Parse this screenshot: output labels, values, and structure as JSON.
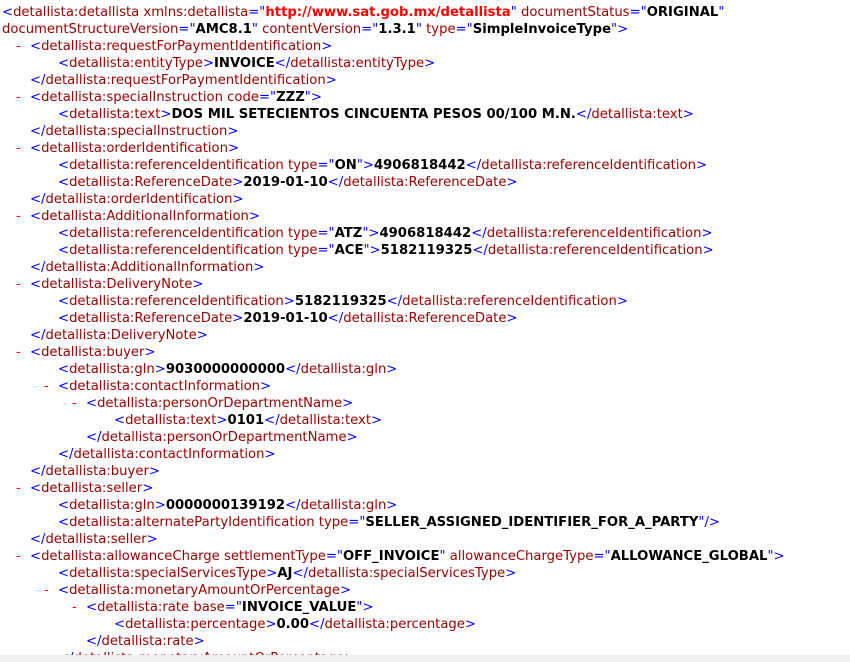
{
  "lines": [
    {
      "i": 0,
      "toggle": "",
      "parts": [
        [
          "b",
          "<"
        ],
        [
          "t",
          "detallista:detallista"
        ],
        [
          "an",
          " xmlns:detallista"
        ],
        [
          "b",
          "=\""
        ],
        [
          "ns",
          "http://www.sat.gob.mx/detallista"
        ],
        [
          "b",
          "\""
        ],
        [
          "an",
          " documentStatus"
        ],
        [
          "b",
          "=\""
        ],
        [
          "av",
          "ORIGINAL"
        ],
        [
          "b",
          "\""
        ]
      ]
    },
    {
      "i": 0,
      "toggle": "",
      "parts": [
        [
          "an",
          "documentStructureVersion"
        ],
        [
          "b",
          "=\""
        ],
        [
          "av",
          "AMC8.1"
        ],
        [
          "b",
          "\""
        ],
        [
          "an",
          " contentVersion"
        ],
        [
          "b",
          "=\""
        ],
        [
          "av",
          "1.3.1"
        ],
        [
          "b",
          "\""
        ],
        [
          "an",
          " type"
        ],
        [
          "b",
          "=\""
        ],
        [
          "av",
          "SimpleInvoiceType"
        ],
        [
          "b",
          "\">"
        ]
      ]
    },
    {
      "i": 1,
      "toggle": "-",
      "parts": [
        [
          "b",
          "<"
        ],
        [
          "t",
          "detallista:requestForPaymentIdentification"
        ],
        [
          "b",
          ">"
        ]
      ]
    },
    {
      "i": 2,
      "toggle": "",
      "parts": [
        [
          "b",
          "<"
        ],
        [
          "t",
          "detallista:entityType"
        ],
        [
          "b",
          ">"
        ],
        [
          "tx",
          "INVOICE"
        ],
        [
          "b",
          "</"
        ],
        [
          "t",
          "detallista:entityType"
        ],
        [
          "b",
          ">"
        ]
      ]
    },
    {
      "i": 1,
      "toggle": "",
      "parts": [
        [
          "b",
          "</"
        ],
        [
          "t",
          "detallista:requestForPaymentIdentification"
        ],
        [
          "b",
          ">"
        ]
      ]
    },
    {
      "i": 1,
      "toggle": "-",
      "parts": [
        [
          "b",
          "<"
        ],
        [
          "t",
          "detallista:specialInstruction"
        ],
        [
          "an",
          " code"
        ],
        [
          "b",
          "=\""
        ],
        [
          "av",
          "ZZZ"
        ],
        [
          "b",
          "\">"
        ]
      ]
    },
    {
      "i": 2,
      "toggle": "",
      "parts": [
        [
          "b",
          "<"
        ],
        [
          "t",
          "detallista:text"
        ],
        [
          "b",
          ">"
        ],
        [
          "tx",
          "DOS MIL SETECIENTOS CINCUENTA PESOS 00/100 M.N."
        ],
        [
          "b",
          "</"
        ],
        [
          "t",
          "detallista:text"
        ],
        [
          "b",
          ">"
        ]
      ]
    },
    {
      "i": 1,
      "toggle": "",
      "parts": [
        [
          "b",
          "</"
        ],
        [
          "t",
          "detallista:specialInstruction"
        ],
        [
          "b",
          ">"
        ]
      ]
    },
    {
      "i": 1,
      "toggle": "-",
      "parts": [
        [
          "b",
          "<"
        ],
        [
          "t",
          "detallista:orderIdentification"
        ],
        [
          "b",
          ">"
        ]
      ]
    },
    {
      "i": 2,
      "toggle": "",
      "parts": [
        [
          "b",
          "<"
        ],
        [
          "t",
          "detallista:referenceIdentification"
        ],
        [
          "an",
          " type"
        ],
        [
          "b",
          "=\""
        ],
        [
          "av",
          "ON"
        ],
        [
          "b",
          "\">"
        ],
        [
          "tx",
          "4906818442"
        ],
        [
          "b",
          "</"
        ],
        [
          "t",
          "detallista:referenceIdentification"
        ],
        [
          "b",
          ">"
        ]
      ]
    },
    {
      "i": 2,
      "toggle": "",
      "parts": [
        [
          "b",
          "<"
        ],
        [
          "t",
          "detallista:ReferenceDate"
        ],
        [
          "b",
          ">"
        ],
        [
          "tx",
          "2019-01-10"
        ],
        [
          "b",
          "</"
        ],
        [
          "t",
          "detallista:ReferenceDate"
        ],
        [
          "b",
          ">"
        ]
      ]
    },
    {
      "i": 1,
      "toggle": "",
      "parts": [
        [
          "b",
          "</"
        ],
        [
          "t",
          "detallista:orderIdentification"
        ],
        [
          "b",
          ">"
        ]
      ]
    },
    {
      "i": 1,
      "toggle": "-",
      "parts": [
        [
          "b",
          "<"
        ],
        [
          "t",
          "detallista:AdditionalInformation"
        ],
        [
          "b",
          ">"
        ]
      ]
    },
    {
      "i": 2,
      "toggle": "",
      "parts": [
        [
          "b",
          "<"
        ],
        [
          "t",
          "detallista:referenceIdentification"
        ],
        [
          "an",
          " type"
        ],
        [
          "b",
          "=\""
        ],
        [
          "av",
          "ATZ"
        ],
        [
          "b",
          "\">"
        ],
        [
          "tx",
          "4906818442"
        ],
        [
          "b",
          "</"
        ],
        [
          "t",
          "detallista:referenceIdentification"
        ],
        [
          "b",
          ">"
        ]
      ]
    },
    {
      "i": 2,
      "toggle": "",
      "parts": [
        [
          "b",
          "<"
        ],
        [
          "t",
          "detallista:referenceIdentification"
        ],
        [
          "an",
          " type"
        ],
        [
          "b",
          "=\""
        ],
        [
          "av",
          "ACE"
        ],
        [
          "b",
          "\">"
        ],
        [
          "tx",
          "5182119325"
        ],
        [
          "b",
          "</"
        ],
        [
          "t",
          "detallista:referenceIdentification"
        ],
        [
          "b",
          ">"
        ]
      ]
    },
    {
      "i": 1,
      "toggle": "",
      "parts": [
        [
          "b",
          "</"
        ],
        [
          "t",
          "detallista:AdditionalInformation"
        ],
        [
          "b",
          ">"
        ]
      ]
    },
    {
      "i": 1,
      "toggle": "-",
      "parts": [
        [
          "b",
          "<"
        ],
        [
          "t",
          "detallista:DeliveryNote"
        ],
        [
          "b",
          ">"
        ]
      ]
    },
    {
      "i": 2,
      "toggle": "",
      "parts": [
        [
          "b",
          "<"
        ],
        [
          "t",
          "detallista:referenceIdentification"
        ],
        [
          "b",
          ">"
        ],
        [
          "tx",
          "5182119325"
        ],
        [
          "b",
          "</"
        ],
        [
          "t",
          "detallista:referenceIdentification"
        ],
        [
          "b",
          ">"
        ]
      ]
    },
    {
      "i": 2,
      "toggle": "",
      "parts": [
        [
          "b",
          "<"
        ],
        [
          "t",
          "detallista:ReferenceDate"
        ],
        [
          "b",
          ">"
        ],
        [
          "tx",
          "2019-01-10"
        ],
        [
          "b",
          "</"
        ],
        [
          "t",
          "detallista:ReferenceDate"
        ],
        [
          "b",
          ">"
        ]
      ]
    },
    {
      "i": 1,
      "toggle": "",
      "parts": [
        [
          "b",
          "</"
        ],
        [
          "t",
          "detallista:DeliveryNote"
        ],
        [
          "b",
          ">"
        ]
      ]
    },
    {
      "i": 1,
      "toggle": "-",
      "parts": [
        [
          "b",
          "<"
        ],
        [
          "t",
          "detallista:buyer"
        ],
        [
          "b",
          ">"
        ]
      ]
    },
    {
      "i": 2,
      "toggle": "",
      "parts": [
        [
          "b",
          "<"
        ],
        [
          "t",
          "detallista:gln"
        ],
        [
          "b",
          ">"
        ],
        [
          "tx",
          "9030000000000"
        ],
        [
          "b",
          "</"
        ],
        [
          "t",
          "detallista:gln"
        ],
        [
          "b",
          ">"
        ]
      ]
    },
    {
      "i": 2,
      "toggle": "-",
      "parts": [
        [
          "b",
          "<"
        ],
        [
          "t",
          "detallista:contactInformation"
        ],
        [
          "b",
          ">"
        ]
      ]
    },
    {
      "i": 3,
      "toggle": "-",
      "parts": [
        [
          "b",
          "<"
        ],
        [
          "t",
          "detallista:personOrDepartmentName"
        ],
        [
          "b",
          ">"
        ]
      ]
    },
    {
      "i": 4,
      "toggle": "",
      "parts": [
        [
          "b",
          "<"
        ],
        [
          "t",
          "detallista:text"
        ],
        [
          "b",
          ">"
        ],
        [
          "tx",
          "0101"
        ],
        [
          "b",
          "</"
        ],
        [
          "t",
          "detallista:text"
        ],
        [
          "b",
          ">"
        ]
      ]
    },
    {
      "i": 3,
      "toggle": "",
      "parts": [
        [
          "b",
          "</"
        ],
        [
          "t",
          "detallista:personOrDepartmentName"
        ],
        [
          "b",
          ">"
        ]
      ]
    },
    {
      "i": 2,
      "toggle": "",
      "parts": [
        [
          "b",
          "</"
        ],
        [
          "t",
          "detallista:contactInformation"
        ],
        [
          "b",
          ">"
        ]
      ]
    },
    {
      "i": 1,
      "toggle": "",
      "parts": [
        [
          "b",
          "</"
        ],
        [
          "t",
          "detallista:buyer"
        ],
        [
          "b",
          ">"
        ]
      ]
    },
    {
      "i": 1,
      "toggle": "-",
      "parts": [
        [
          "b",
          "<"
        ],
        [
          "t",
          "detallista:seller"
        ],
        [
          "b",
          ">"
        ]
      ]
    },
    {
      "i": 2,
      "toggle": "",
      "parts": [
        [
          "b",
          "<"
        ],
        [
          "t",
          "detallista:gln"
        ],
        [
          "b",
          ">"
        ],
        [
          "tx",
          "0000000139192"
        ],
        [
          "b",
          "</"
        ],
        [
          "t",
          "detallista:gln"
        ],
        [
          "b",
          ">"
        ]
      ]
    },
    {
      "i": 2,
      "toggle": "",
      "parts": [
        [
          "b",
          "<"
        ],
        [
          "t",
          "detallista:alternatePartyIdentification"
        ],
        [
          "an",
          " type"
        ],
        [
          "b",
          "=\""
        ],
        [
          "av",
          "SELLER_ASSIGNED_IDENTIFIER_FOR_A_PARTY"
        ],
        [
          "b",
          "\"/>"
        ]
      ]
    },
    {
      "i": 1,
      "toggle": "",
      "parts": [
        [
          "b",
          "</"
        ],
        [
          "t",
          "detallista:seller"
        ],
        [
          "b",
          ">"
        ]
      ]
    },
    {
      "i": 1,
      "toggle": "-",
      "parts": [
        [
          "b",
          "<"
        ],
        [
          "t",
          "detallista:allowanceCharge"
        ],
        [
          "an",
          " settlementType"
        ],
        [
          "b",
          "=\""
        ],
        [
          "av",
          "OFF_INVOICE"
        ],
        [
          "b",
          "\""
        ],
        [
          "an",
          " allowanceChargeType"
        ],
        [
          "b",
          "=\""
        ],
        [
          "av",
          "ALLOWANCE_GLOBAL"
        ],
        [
          "b",
          "\">"
        ]
      ]
    },
    {
      "i": 2,
      "toggle": "",
      "parts": [
        [
          "b",
          "<"
        ],
        [
          "t",
          "detallista:specialServicesType"
        ],
        [
          "b",
          ">"
        ],
        [
          "tx",
          "AJ"
        ],
        [
          "b",
          "</"
        ],
        [
          "t",
          "detallista:specialServicesType"
        ],
        [
          "b",
          ">"
        ]
      ]
    },
    {
      "i": 2,
      "toggle": "-",
      "parts": [
        [
          "b",
          "<"
        ],
        [
          "t",
          "detallista:monetaryAmountOrPercentage"
        ],
        [
          "b",
          ">"
        ]
      ]
    },
    {
      "i": 3,
      "toggle": "-",
      "parts": [
        [
          "b",
          "<"
        ],
        [
          "t",
          "detallista:rate"
        ],
        [
          "an",
          " base"
        ],
        [
          "b",
          "=\""
        ],
        [
          "av",
          "INVOICE_VALUE"
        ],
        [
          "b",
          "\">"
        ]
      ]
    },
    {
      "i": 4,
      "toggle": "",
      "parts": [
        [
          "b",
          "<"
        ],
        [
          "t",
          "detallista:percentage"
        ],
        [
          "b",
          ">"
        ],
        [
          "tx",
          "0.00"
        ],
        [
          "b",
          "</"
        ],
        [
          "t",
          "detallista:percentage"
        ],
        [
          "b",
          ">"
        ]
      ]
    },
    {
      "i": 3,
      "toggle": "",
      "parts": [
        [
          "b",
          "</"
        ],
        [
          "t",
          "detallista:rate"
        ],
        [
          "b",
          ">"
        ]
      ]
    },
    {
      "i": 2,
      "toggle": "",
      "parts": [
        [
          "b",
          "</"
        ],
        [
          "t",
          "detallista:monetaryAmountOrPercentage"
        ],
        [
          "b",
          ">"
        ]
      ]
    }
  ]
}
